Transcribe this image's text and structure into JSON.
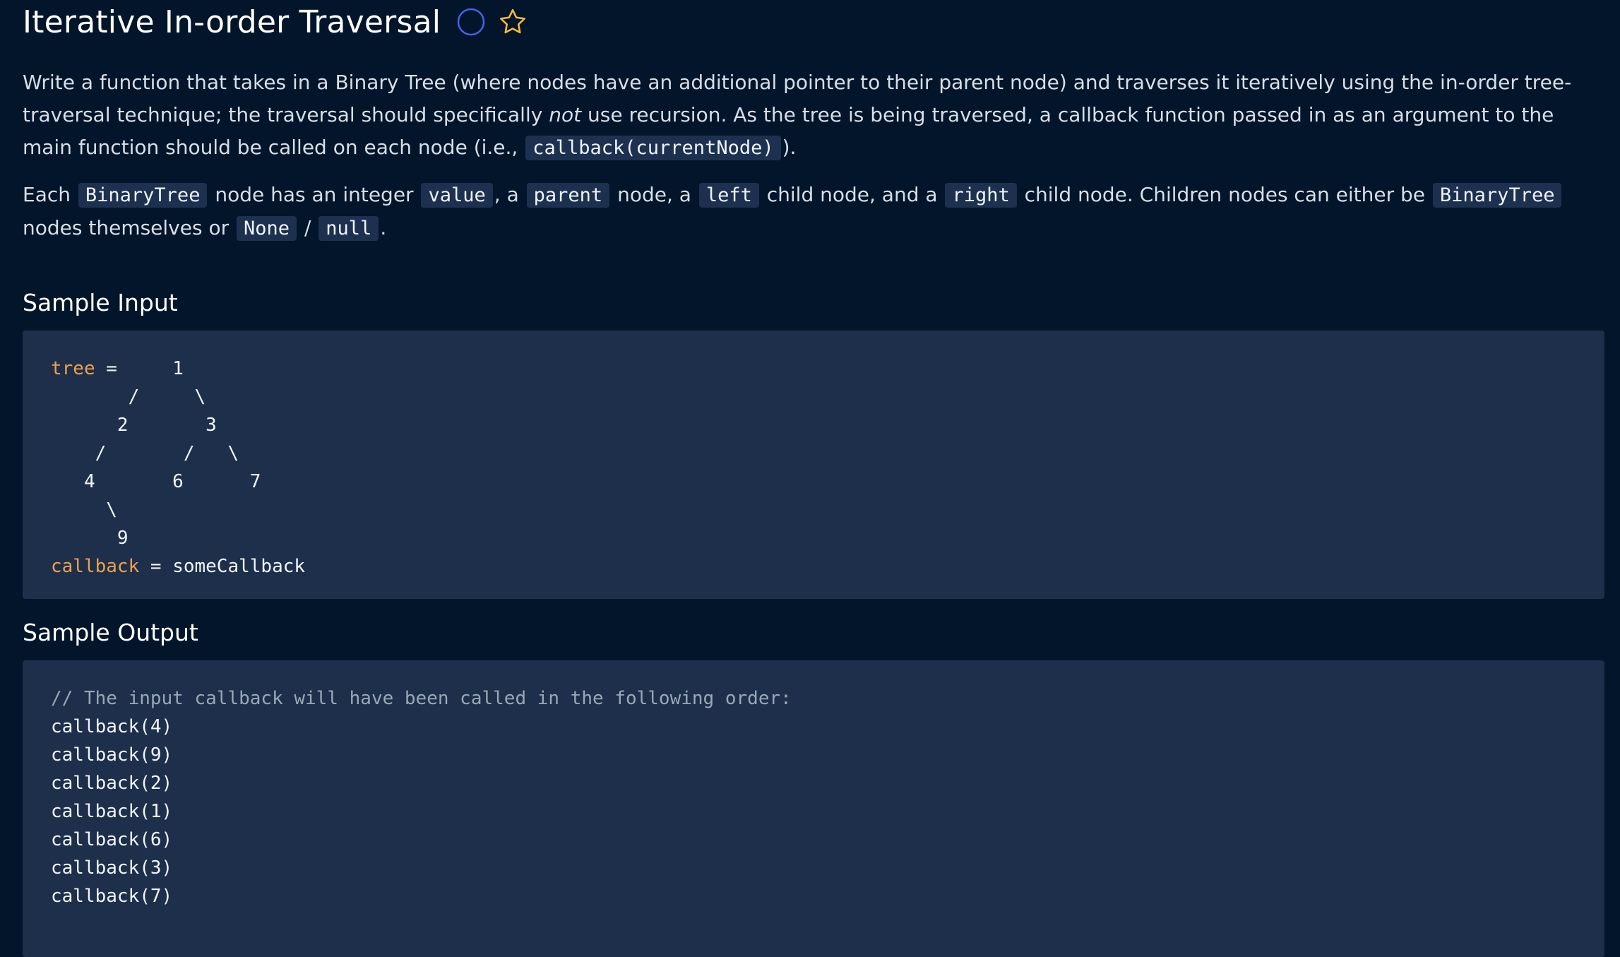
{
  "problem": {
    "title": "Iterative In-order Traversal",
    "status_icon": "circle-outline-icon",
    "favorite_icon": "star-outline-icon"
  },
  "description": {
    "p1_a": "Write a function that takes in a Binary Tree (where nodes have an additional pointer to their parent node) and traverses it iteratively using the in-order tree-traversal technique; the traversal should specifically ",
    "p1_em": "not",
    "p1_b": " use recursion. As the tree is being traversed, a callback function passed in as an argument to the main function should be called on each node (i.e., ",
    "p1_code": "callback(currentNode)",
    "p1_c": ").",
    "p2_a": "Each ",
    "p2_code1": "BinaryTree",
    "p2_b": " node has an integer ",
    "p2_code2": "value",
    "p2_c": ", a ",
    "p2_code3": "parent",
    "p2_d": " node, a ",
    "p2_code4": "left",
    "p2_e": " child node, and a ",
    "p2_code5": "right",
    "p2_f": " child node. Children nodes can either be ",
    "p2_code6": "BinaryTree",
    "p2_g": " nodes themselves or ",
    "p2_code7": "None",
    "p2_h": " / ",
    "p2_code8": "null",
    "p2_i": "."
  },
  "sample_input": {
    "heading": "Sample Input",
    "tree_var": "tree",
    "tree_eq": " =     1",
    "tree_lines": [
      "       /     \\",
      "      2       3",
      "    /       /   \\",
      "   4       6      7",
      "     \\",
      "      9"
    ],
    "callback_var": "callback",
    "callback_rest": " = someCallback"
  },
  "sample_output": {
    "heading": "Sample Output",
    "comment": "// The input callback will have been called in the following order:",
    "lines": [
      "callback(4)",
      "callback(9)",
      "callback(2)",
      "callback(1)",
      "callback(6)",
      "callback(3)",
      "callback(7)"
    ]
  },
  "colors": {
    "background": "#02152a",
    "code_background": "#1d2f4b",
    "keyword": "#f0a04b",
    "status_icon": "#3b5bdb",
    "star_icon": "#f5b942"
  }
}
